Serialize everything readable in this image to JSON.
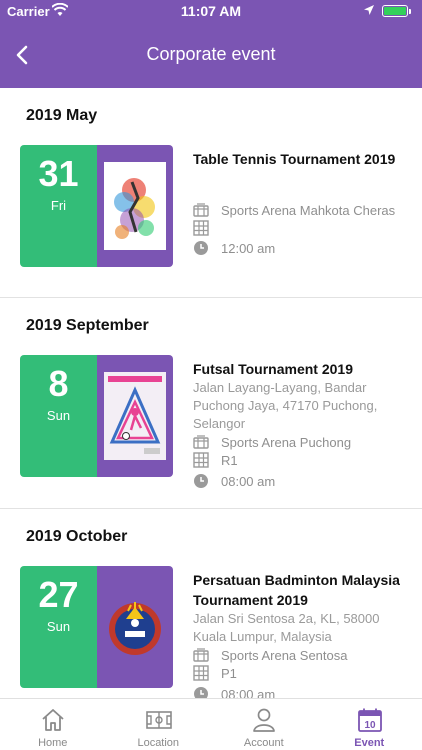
{
  "status_bar": {
    "carrier": "Carrier",
    "time": "11:07 AM"
  },
  "nav": {
    "title": "Corporate event"
  },
  "sections": [
    {
      "month": "2019 May",
      "event": {
        "day": "31",
        "weekday": "Fri",
        "title": "Table Tennis Tournament 2019",
        "address": "",
        "venue": "Sports Arena Mahkota Cheras",
        "court": "",
        "time": "12:00 am"
      }
    },
    {
      "month": "2019 September",
      "event": {
        "day": "8",
        "weekday": "Sun",
        "title": "Futsal Tournament 2019",
        "address": "Jalan Layang-Layang, Bandar Puchong Jaya, 47170 Puchong, Selangor",
        "venue": "Sports Arena Puchong",
        "court": "R1",
        "time": "08:00 am"
      }
    },
    {
      "month": "2019 October",
      "event": {
        "day": "27",
        "weekday": "Sun",
        "title": "Persatuan Badminton Malaysia Tournament 2019",
        "address": "Jalan Sri Sentosa 2a, KL, 58000 Kuala Lumpur, Malaysia",
        "venue": "Sports Arena Sentosa",
        "court": "P1",
        "time": "08:00 am"
      }
    }
  ],
  "tabs": [
    {
      "label": "Home",
      "icon": "home-icon"
    },
    {
      "label": "Location",
      "icon": "court-icon"
    },
    {
      "label": "Account",
      "icon": "user-icon"
    },
    {
      "label": "Event",
      "icon": "calendar-icon",
      "badge": "10",
      "active": true
    }
  ],
  "colors": {
    "primary": "#7b55b3",
    "date_green": "#33bd78"
  }
}
